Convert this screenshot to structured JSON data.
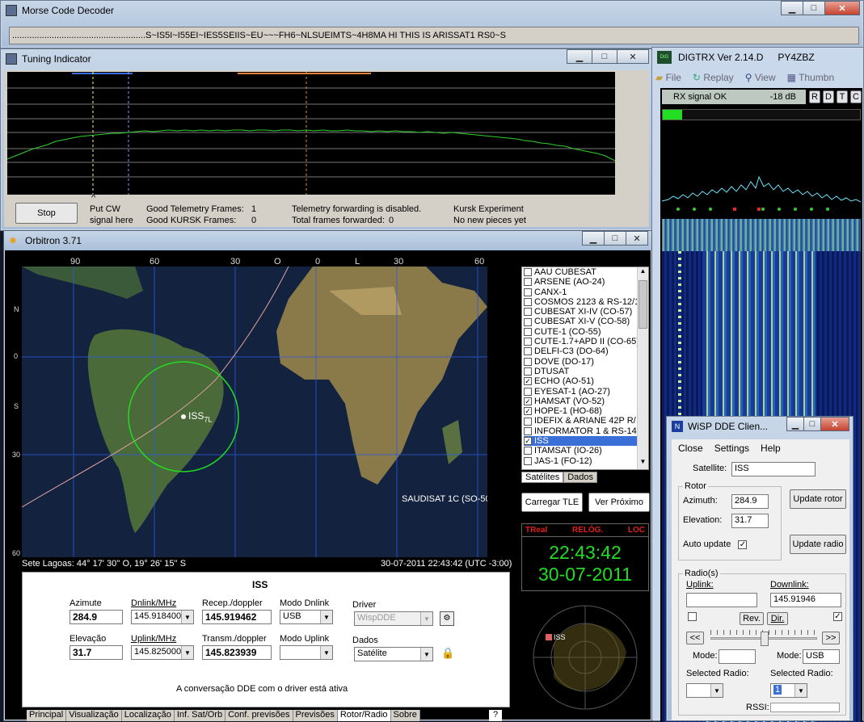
{
  "morse": {
    "title": "Morse Code Decoder",
    "text": "......................................................S~IS5I~I55EI~IES5SEIIS~EU~~~FH6~NLSUEIMTS~4H8MA HI THIS IS ARISSAT1 RS0~S"
  },
  "tuning": {
    "title": "Tuning Indicator",
    "stop_label": "Stop",
    "cw_line1": "Put CW",
    "cw_line2": "signal here",
    "caret": "^",
    "good_tlm": "Good Telemetry Frames:",
    "good_tlm_val": "1",
    "good_kursk": "Good KURSK Frames:",
    "good_kursk_val": "0",
    "tlm_fwd": "Telemetry forwarding is disabled.",
    "total_fwd": "Total frames forwarded:",
    "total_fwd_val": "0",
    "kursk_exp": "Kursk Experiment",
    "kursk_none": "No new pieces yet"
  },
  "orbitron": {
    "title": "Orbitron 3.71",
    "top_ticks": [
      "90",
      "60",
      "30",
      "O",
      "0",
      "L",
      "30",
      "60"
    ],
    "left_ticks": [
      "N",
      "0",
      "S",
      "30",
      "60"
    ],
    "iss_label": "ISS",
    "iss_sub": "7L",
    "saudisat_label": "SAUDISAT 1C (SO-50)",
    "location": "Sete Lagoas: 44° 17' 30'' O, 19° 26' 15'' S",
    "datetime": "30-07-2011 22:43:42 (UTC -3:00)",
    "satellites": [
      {
        "name": "AAU CUBESAT",
        "checked": false
      },
      {
        "name": "ARSENE (AO-24)",
        "checked": false
      },
      {
        "name": "CANX-1",
        "checked": false
      },
      {
        "name": "COSMOS 2123 & RS-12/1",
        "checked": false
      },
      {
        "name": "CUBESAT XI-IV (CO-57)",
        "checked": false
      },
      {
        "name": "CUBESAT XI-V (CO-58)",
        "checked": false
      },
      {
        "name": "CUTE-1 (CO-55)",
        "checked": false
      },
      {
        "name": "CUTE-1.7+APD II (CO-65)",
        "checked": false
      },
      {
        "name": "DELFI-C3 (DO-64)",
        "checked": false
      },
      {
        "name": "DOVE (DO-17)",
        "checked": false
      },
      {
        "name": "DTUSAT",
        "checked": false
      },
      {
        "name": "ECHO (AO-51)",
        "checked": true
      },
      {
        "name": "EYESAT-1 (AO-27)",
        "checked": false
      },
      {
        "name": "HAMSAT (VO-52)",
        "checked": true
      },
      {
        "name": "HOPE-1 (HO-68)",
        "checked": true
      },
      {
        "name": "IDEFIX & ARIANE 42P R/",
        "checked": false
      },
      {
        "name": "INFORMATOR 1 & RS-14",
        "checked": false
      },
      {
        "name": "ISS",
        "checked": true,
        "selected": true
      },
      {
        "name": "ITAMSAT (IO-26)",
        "checked": false
      },
      {
        "name": "JAS-1 (FO-12)",
        "checked": false
      }
    ],
    "list_tabs": [
      "Satélites",
      "Dados"
    ],
    "load_tle": "Carregar TLE",
    "next": "Ver Próximo",
    "clock_tags": [
      "TReal",
      "RELÓG.",
      "LOC"
    ],
    "clock_time": "22:43:42",
    "clock_date": "30-07-2011",
    "radar_label": "ISS",
    "panel": {
      "sat_name": "ISS",
      "az_label": "Azimute",
      "az_val": "284.9",
      "el_label": "Elevação",
      "el_val": "31.7",
      "dn_label": "Dnlink/MHz",
      "dn_val": "145.918400",
      "up_label": "Uplink/MHz",
      "up_val": "145.825000",
      "rec_label": "Recep./doppler",
      "rec_val": "145.919462",
      "tx_label": "Transm./doppler",
      "tx_val": "145.823939",
      "mode_dn_label": "Modo Dnlink",
      "mode_dn_val": "USB",
      "mode_up_label": "Modo Uplink",
      "mode_up_val": "",
      "driver_label": "Driver",
      "driver_val": "WispDDE",
      "dados_label": "Dados",
      "dados_val": "Satélite",
      "status": "A conversação DDE com o driver está ativa"
    },
    "tabs": [
      "Principal",
      "Visualização",
      "Localização",
      "Inf. Sat/Orb",
      "Conf. previsões",
      "Previsões",
      "Rotor/Radio",
      "Sobre"
    ],
    "help": "?"
  },
  "digtrx": {
    "title": "DIGTRX  Ver 2.14.D",
    "callsign": "PY4ZBZ",
    "menu": [
      "File",
      "Replay",
      "View",
      "Thumbn"
    ],
    "rx_status": "RX signal OK",
    "rx_db": "-18 dB",
    "flags": [
      "R",
      "D",
      "T",
      "C"
    ],
    "level": 0.1
  },
  "wisp": {
    "title": "WiSP DDE Clien...",
    "menu": [
      "Close",
      "Settings",
      "Help"
    ],
    "sat_label": "Satellite:",
    "sat_val": "ISS",
    "rotor_group": "Rotor",
    "az_label": "Azimuth:",
    "az_val": "284.9",
    "el_label": "Elevation:",
    "el_val": "31.7",
    "update_rotor": "Update rotor",
    "auto_update": "Auto update",
    "update_radio": "Update radio",
    "radio_group": "Radio(s)",
    "uplink_label": "Uplink:",
    "uplink_val": "",
    "downlink_label": "Downlink:",
    "downlink_val": "145.91946",
    "rev": "Rev.",
    "dir": "Dir.",
    "left_arrows": "<<",
    "right_arrows": ">>",
    "mode_label": "Mode:",
    "mode_left": "",
    "mode_right": "USB",
    "sel_label": "Selected Radio:",
    "sel_left": "",
    "sel_right": "1",
    "rssi_label": "RSSI:"
  }
}
